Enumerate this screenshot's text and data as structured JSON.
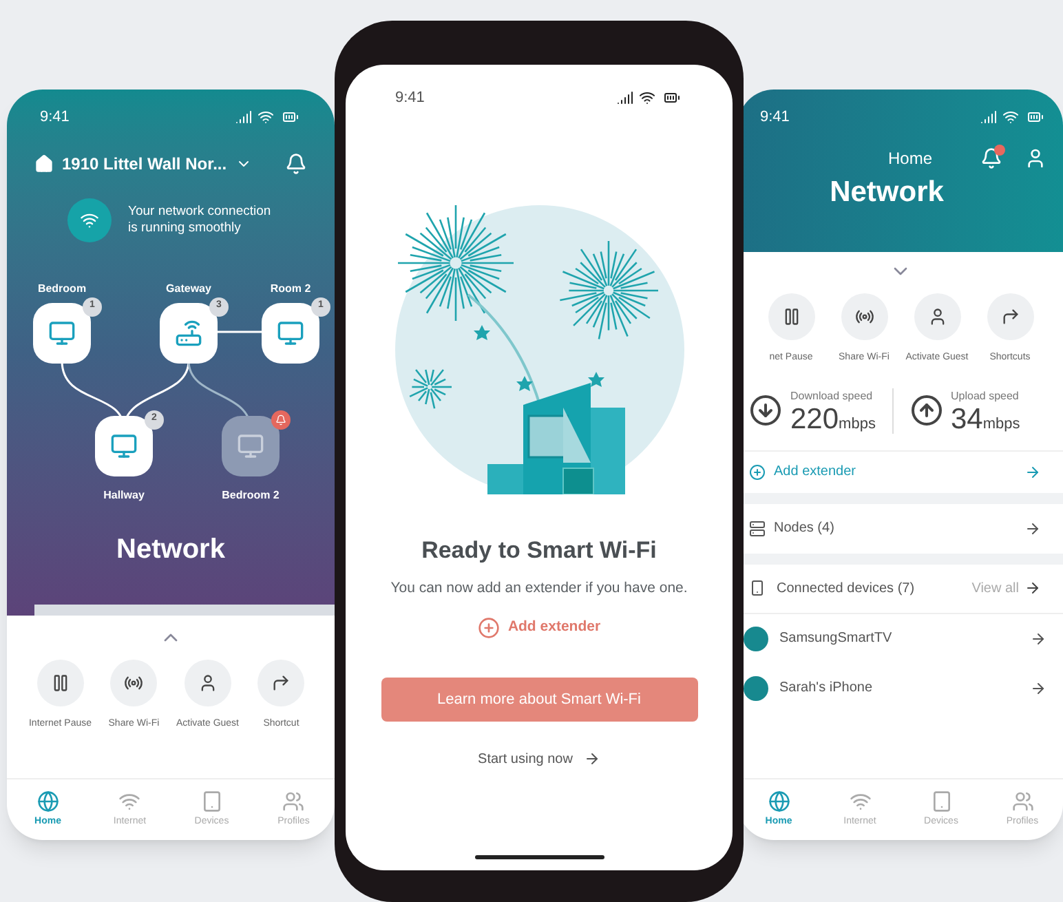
{
  "left_screen": {
    "status_time": "9:41",
    "location": "1910 Littel Wall Nor...",
    "status_message": "Your network connection is running smoothly",
    "nodes": [
      {
        "label": "Bedroom",
        "badge": "1",
        "alert": false
      },
      {
        "label": "Gateway",
        "badge": "3",
        "alert": false
      },
      {
        "label": "Room 2",
        "badge": "1",
        "alert": false
      },
      {
        "label": "Hallway",
        "badge": "2",
        "alert": false
      },
      {
        "label": "Bedroom 2",
        "alert": true
      }
    ],
    "title": "Network",
    "actions": [
      {
        "kind": "pause",
        "label": "Internet Pause"
      },
      {
        "kind": "share",
        "label": "Share Wi-Fi"
      },
      {
        "kind": "guest",
        "label": "Activate Guest"
      },
      {
        "kind": "shortcut",
        "label": "Shortcut"
      }
    ],
    "nav": [
      {
        "kind": "home",
        "label": "Home",
        "selected": true
      },
      {
        "kind": "internet",
        "label": "Internet",
        "selected": false
      },
      {
        "kind": "devices",
        "label": "Devices",
        "selected": false
      },
      {
        "kind": "profiles",
        "label": "Profiles",
        "selected": false
      }
    ]
  },
  "center_screen": {
    "status_time": "9:41",
    "title": "Ready to Smart Wi-Fi",
    "subtitle": "You can now add an extender if you have one.",
    "add_link": "Add extender",
    "primary_button": "Learn more about Smart Wi-Fi",
    "secondary_link": "Start using now"
  },
  "right_screen": {
    "status_time": "9:41",
    "subtitle": "Home",
    "title": "Network",
    "notification": true,
    "actions": [
      {
        "kind": "pause",
        "label": "net Pause"
      },
      {
        "kind": "share",
        "label": "Share Wi-Fi"
      },
      {
        "kind": "guest",
        "label": "Activate Guest"
      },
      {
        "kind": "shortcut",
        "label": "Shortcuts"
      }
    ],
    "speeds": [
      {
        "kind": "download",
        "label": "Download speed",
        "value": "220",
        "unit": "mbps"
      },
      {
        "kind": "upload",
        "label": "Upload speed",
        "value": "34",
        "unit": "mbps"
      }
    ],
    "rows": [
      {
        "kind": "link",
        "label": "Add extender"
      },
      {
        "kind": "nodes",
        "label": "Nodes (4)"
      },
      {
        "kind": "header",
        "label": "Connected devices (7)",
        "action": "View all"
      },
      {
        "kind": "device",
        "label": "SamsungSmartTV"
      },
      {
        "kind": "device",
        "label": "Sarah's iPhone"
      }
    ],
    "nav": [
      {
        "kind": "home",
        "label": "Home",
        "selected": true
      },
      {
        "kind": "internet",
        "label": "Internet",
        "selected": false
      },
      {
        "kind": "devices",
        "label": "Devices",
        "selected": false
      },
      {
        "kind": "profiles",
        "label": "Profiles",
        "selected": false
      }
    ]
  }
}
